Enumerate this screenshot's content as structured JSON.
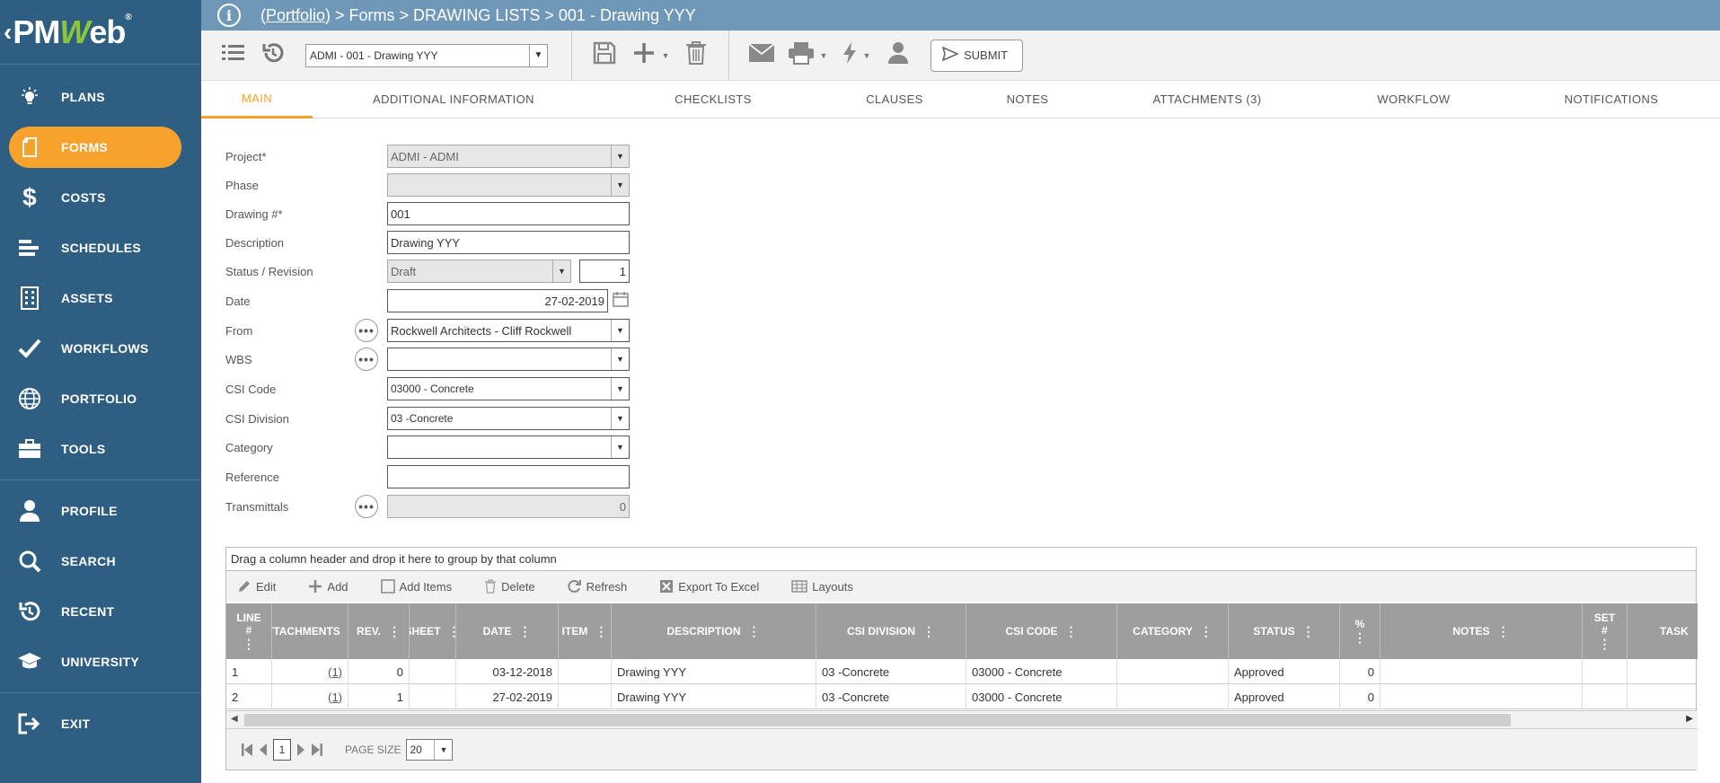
{
  "app": {
    "logo_prefix": "PM",
    "logo_w": "W",
    "logo_suffix": "eb",
    "logo_reg": "®"
  },
  "breadcrumb": {
    "link": "(Portfolio)",
    "rest": " > Forms > DRAWING LISTS > 001 - Drawing YYY"
  },
  "sidebar": {
    "items": [
      {
        "label": "PLANS",
        "icon": "lightbulb-icon"
      },
      {
        "label": "FORMS",
        "icon": "document-icon",
        "active": true
      },
      {
        "label": "COSTS",
        "icon": "dollar-icon"
      },
      {
        "label": "SCHEDULES",
        "icon": "schedule-bars-icon"
      },
      {
        "label": "ASSETS",
        "icon": "building-icon"
      },
      {
        "label": "WORKFLOWS",
        "icon": "checkmark-icon"
      },
      {
        "label": "PORTFOLIO",
        "icon": "globe-icon"
      },
      {
        "label": "TOOLS",
        "icon": "briefcase-icon"
      },
      {
        "label": "PROFILE",
        "icon": "user-icon"
      },
      {
        "label": "SEARCH",
        "icon": "search-icon"
      },
      {
        "label": "RECENT",
        "icon": "history-icon"
      },
      {
        "label": "UNIVERSITY",
        "icon": "graduation-cap-icon"
      },
      {
        "label": "EXIT",
        "icon": "exit-icon"
      }
    ]
  },
  "toolbar": {
    "record_select": "ADMI - 001 - Drawing YYY",
    "submit_label": "SUBMIT"
  },
  "tabs": [
    {
      "label": "MAIN",
      "active": true
    },
    {
      "label": "ADDITIONAL INFORMATION"
    },
    {
      "label": "CHECKLISTS"
    },
    {
      "label": "CLAUSES"
    },
    {
      "label": "NOTES"
    },
    {
      "label": "ATTACHMENTS (3)"
    },
    {
      "label": "WORKFLOW"
    },
    {
      "label": "NOTIFICATIONS"
    }
  ],
  "form": {
    "project": {
      "label": "Project*",
      "value": "ADMI - ADMI"
    },
    "phase": {
      "label": "Phase",
      "value": ""
    },
    "drawing_no": {
      "label": "Drawing #*",
      "value": "001"
    },
    "description": {
      "label": "Description",
      "value": "Drawing YYY"
    },
    "status_revision": {
      "label": "Status / Revision",
      "status": "Draft",
      "revision": "1"
    },
    "date": {
      "label": "Date",
      "value": "27-02-2019"
    },
    "from": {
      "label": "From",
      "value": "Rockwell Architects - Cliff Rockwell"
    },
    "wbs": {
      "label": "WBS",
      "value": ""
    },
    "csi_code": {
      "label": "CSI Code",
      "value": "03000 - Concrete"
    },
    "csi_division": {
      "label": "CSI Division",
      "value": "03 -Concrete"
    },
    "category": {
      "label": "Category",
      "value": ""
    },
    "reference": {
      "label": "Reference",
      "value": ""
    },
    "transmittals": {
      "label": "Transmittals",
      "value": "0"
    }
  },
  "grid": {
    "group_hint": "Drag a column header and drop it here to group by that column",
    "tools": {
      "edit": "Edit",
      "add": "Add",
      "add_items": "Add Items",
      "delete": "Delete",
      "refresh": "Refresh",
      "export": "Export To Excel",
      "layouts": "Layouts"
    },
    "columns": {
      "line": "LINE #",
      "attachments": "ATTACHMENTS",
      "rev": "REV.",
      "sheet": "SHEET",
      "date": "DATE",
      "item": "ITEM",
      "description": "DESCRIPTION",
      "csi_division": "CSI DIVISION",
      "csi_code": "CSI CODE",
      "category": "CATEGORY",
      "status": "STATUS",
      "percent": "%",
      "notes": "NOTES",
      "set": "SET #",
      "task": "TASK"
    },
    "rows": [
      {
        "line": "1",
        "attachments": "(1)",
        "rev": "0",
        "sheet": "",
        "date": "03-12-2018",
        "item": "",
        "description": "Drawing YYY",
        "csi_division": "03 -Concrete",
        "csi_code": "03000 - Concrete",
        "category": "",
        "status": "Approved",
        "percent": "0",
        "notes": "",
        "set": "",
        "task": ""
      },
      {
        "line": "2",
        "attachments": "(1)",
        "rev": "1",
        "sheet": "",
        "date": "27-02-2019",
        "item": "",
        "description": "Drawing YYY",
        "csi_division": "03 -Concrete",
        "csi_code": "03000 - Concrete",
        "category": "",
        "status": "Approved",
        "percent": "0",
        "notes": "",
        "set": "",
        "task": ""
      }
    ],
    "pager": {
      "page": "1",
      "page_size_label": "PAGE SIZE",
      "page_size": "20"
    }
  },
  "colors": {
    "sidebar": "#2e5f82",
    "accent": "#f6a22d",
    "topbar": "#6f98b8",
    "grid_header": "#9e9e9e"
  }
}
